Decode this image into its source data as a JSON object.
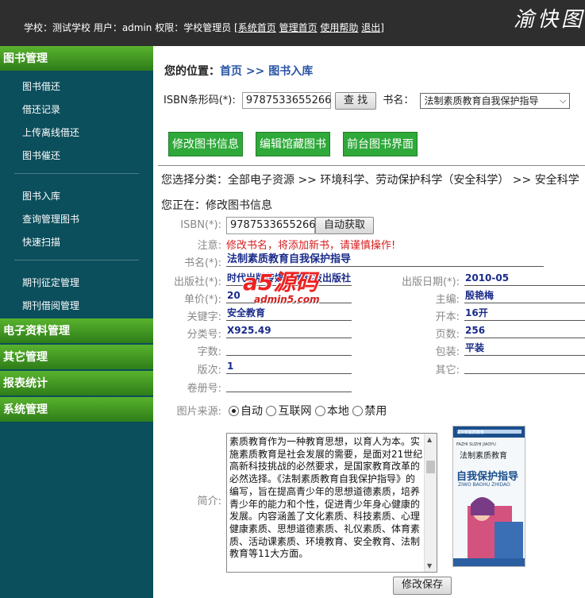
{
  "header": {
    "userinfo_text": "学校：测试学校 用户：admin 权限：学校管理员 [",
    "links": [
      "系统首页",
      "管理首页",
      "使用帮助",
      "退出"
    ],
    "userinfo_end": "]",
    "logo_text": "渝快图"
  },
  "sidebar": {
    "book_mgmt_title": "图书管理",
    "group1": [
      "图书借还",
      "借还记录",
      "上传离线借还",
      "图书催还"
    ],
    "group2": [
      "图书入库",
      "查询管理图书",
      "快速扫描"
    ],
    "group3": [
      "期刊征定管理",
      "期刊借阅管理"
    ],
    "sections": [
      "电子资料管理",
      "其它管理",
      "报表统计",
      "系统管理"
    ]
  },
  "location": {
    "label": "您的位置：",
    "home": "首页",
    "sep": " >> ",
    "current": "图书入库"
  },
  "search": {
    "isbn_label": "ISBN条形码(*):",
    "isbn_value": "9787533655266",
    "search_button": "查 找",
    "title_label": "书名：",
    "title_selected": "法制素质教育自我保护指导"
  },
  "actions": [
    "修改图书信息",
    "编辑馆藏图书",
    "前台图书界面"
  ],
  "category_text": "您选择分类：全部电子资源 >> 环境科学、劳动保护科学（安全科学） >> 安全科学",
  "editing_text": "您正在：修改图书信息",
  "form": {
    "isbn_label": "ISBN(*):",
    "isbn_value": "9787533655266",
    "auto_fetch": "自动获取",
    "note_label": "注意:",
    "note_text": "修改书名，将添加新书，请谨慎操作!",
    "title_label": "书名(*):",
    "title_value": "法制素质教育自我保护指导",
    "publisher_label": "出版社(*):",
    "publisher_value": "时代出版传媒安徽科技出版社",
    "pubdate_label": "出版日期(*):",
    "pubdate_value": "2010-05",
    "price_label": "单价(*):",
    "price_value": "20",
    "editor_label": "主编:",
    "editor_value": "殷艳梅",
    "keyword_label": "关键字:",
    "keyword_value": "安全教育",
    "format_label": "开本:",
    "format_value": "16开",
    "classno_label": "分类号:",
    "classno_value": "X925.49",
    "pages_label": "页数:",
    "pages_value": "256",
    "words_label": "字数:",
    "words_value": "",
    "binding_label": "包装:",
    "binding_value": "平装",
    "edition_label": "版次:",
    "edition_value": "1",
    "other_label": "其它:",
    "other_value": "",
    "volume_label": "卷册号:",
    "volume_value": "",
    "image_source_label": "图片来源:",
    "image_options": [
      "自动",
      "互联网",
      "本地",
      "禁用"
    ],
    "image_selected": "自动",
    "intro_label": "简介:",
    "intro_text": "素质教育作为一种教育思想，以育人为本。实施素质教育是社会发展的需要，是面对21世纪高新科技挑战的必然要求，是国家教育改革的必然选择。《法制素质教育自我保护指导》的编写，旨在提高青少年的思想道德素质，培养青少年的能力和个性，促进青少年身心健康的发展。内容涵盖了文化素质、科技素质、心理健康素质、思想道德素质、礼仪素质、体育素质、活动课素质、环境教育、安全教育、法制教育等11大方面。",
    "save_button": "修改保存"
  },
  "cover": {
    "series": "青少年素质教育",
    "pinyin_top": "FAZHI SUZHI JIAOYU",
    "title_small": "法制素质教育",
    "title_big": "自我保护指导",
    "pinyin_bottom": "ZIWO BAOHU ZHIDAO"
  },
  "watermark": {
    "logo": "a5源码",
    "site": "admin5.com"
  },
  "colors": {
    "sidebar_bg": "#0b4e5c",
    "section_green": "#3e961f",
    "action_green": "#2fa93a",
    "link_blue": "#2a56a6",
    "value_blue": "#1a2b8a",
    "warn_red": "#d62020"
  }
}
